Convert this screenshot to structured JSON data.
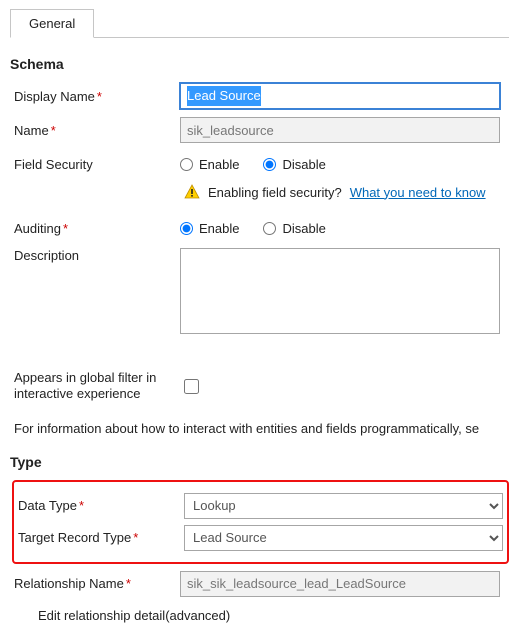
{
  "tabs": {
    "general": "General"
  },
  "sections": {
    "schema": "Schema",
    "type": "Type"
  },
  "labels": {
    "display_name": "Display Name",
    "name": "Name",
    "field_security": "Field Security",
    "auditing": "Auditing",
    "description": "Description",
    "appears_in_global": "Appears in global filter in interactive experience",
    "data_type": "Data Type",
    "target_record_type": "Target Record Type",
    "relationship_name": "Relationship Name"
  },
  "fields": {
    "display_name_value": "Lead Source",
    "name_value": "sik_leadsource",
    "relationship_name_value": "sik_sik_leadsource_lead_LeadSource",
    "data_type_value": "Lookup",
    "target_record_type_value": "Lead Source"
  },
  "radio": {
    "enable": "Enable",
    "disable": "Disable"
  },
  "warning": {
    "text": "Enabling field security?",
    "link": "What you need to know"
  },
  "info_line": "For information about how to interact with entities and fields programmatically, se",
  "edit_relationship": "Edit relationship detail(advanced)",
  "req_marker": "*"
}
